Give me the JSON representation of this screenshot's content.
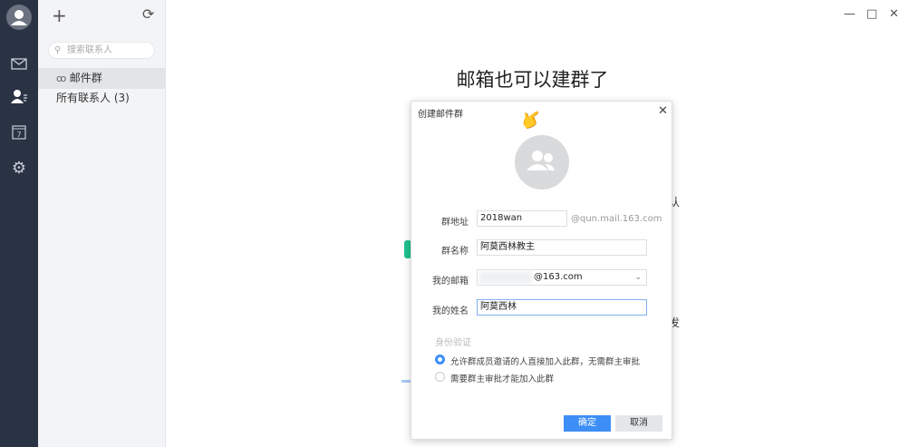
{
  "sidebar": {
    "icons": [
      "avatar-icon",
      "mail-icon",
      "contacts-icon",
      "calendar-icon",
      "settings-icon"
    ],
    "calendar_day": "7"
  },
  "list": {
    "search_placeholder": "搜索联系人",
    "items": [
      {
        "label": "邮件群",
        "selected": true
      },
      {
        "label": "所有联系人 (3)",
        "selected": false
      }
    ]
  },
  "main": {
    "title": "邮箱也可以建群了",
    "bg_fragments": [
      "认",
      "发"
    ]
  },
  "dialog": {
    "title": "创建邮件群",
    "fields": {
      "address_label": "群地址",
      "address_value": "2018wan",
      "address_suffix": "@qun.mail.163.com",
      "name_label": "群名称",
      "name_value": "阿莫西林教主",
      "email_label": "我的邮箱",
      "email_value": "@163.com",
      "myname_label": "我的姓名",
      "myname_value": "阿莫西林"
    },
    "verify_label": "身份验证",
    "options": [
      {
        "label": "允许群成员邀请的人直接加入此群，无需群主审批",
        "checked": true
      },
      {
        "label": "需要群主审批才能加入此群",
        "checked": false
      }
    ],
    "confirm": "确定",
    "cancel": "取消"
  },
  "colors": {
    "accent": "#3d8ef6",
    "nav_bg": "#2a3344"
  }
}
